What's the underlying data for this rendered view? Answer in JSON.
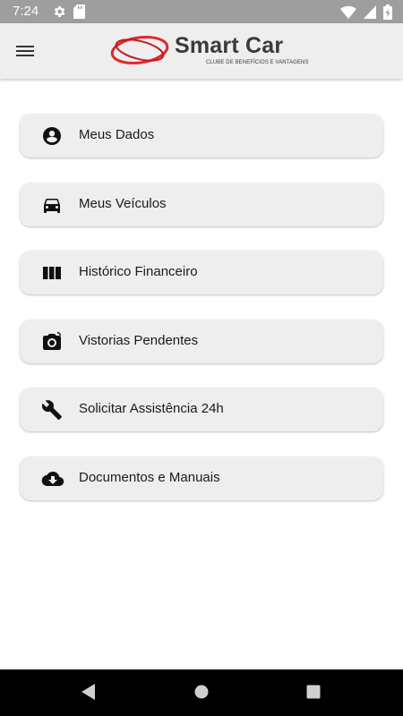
{
  "status_bar": {
    "time": "7:24"
  },
  "app": {
    "logo_title": "Smart Car",
    "logo_subtitle": "CLUBE DE BENEFÍCIOS E VANTAGENS"
  },
  "menu": [
    {
      "label": "Meus Dados",
      "icon": "account-circle-icon"
    },
    {
      "label": "Meus Veículos",
      "icon": "car-icon"
    },
    {
      "label": "Histórico Financeiro",
      "icon": "columns-icon"
    },
    {
      "label": "Vistorias Pendentes",
      "icon": "camera-icon"
    },
    {
      "label": "Solicitar Assistência 24h",
      "icon": "wrench-icon"
    },
    {
      "label": "Documentos e Manuais",
      "icon": "cloud-download-icon"
    }
  ],
  "colors": {
    "accent_red": "#e3262c",
    "app_bar": "#eeeeee",
    "status_bar": "#9e9e9e"
  }
}
